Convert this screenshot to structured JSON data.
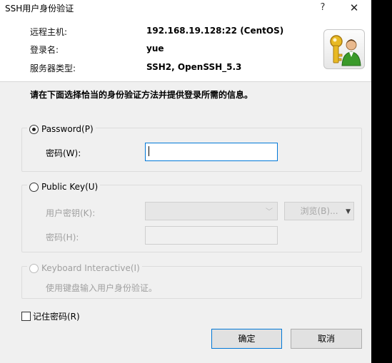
{
  "window": {
    "title": "SSH用户身份验证",
    "help_label": "?",
    "close_label": "✕"
  },
  "info": {
    "host_label": "远程主机:",
    "host_value": "192.168.19.128:22 (CentOS)",
    "login_label": "登录名:",
    "login_value": "yue",
    "server_type_label": "服务器类型:",
    "server_type_value": "SSH2, OpenSSH_5.3",
    "avatar_icon": "user-key-icon"
  },
  "instruction": "请在下面选择恰当的身份验证方法并提供登录所需的信息。",
  "password_method": {
    "label": "Password(P)",
    "selected": true,
    "password_label": "密码(W):",
    "password_value": ""
  },
  "publickey_method": {
    "label": "Public Key(U)",
    "selected": false,
    "user_key_label": "用户密钥(K):",
    "user_key_value": "",
    "browse_label": "浏览(B)...",
    "passphrase_label": "密码(H):",
    "passphrase_value": ""
  },
  "keyboard_method": {
    "label": "Keyboard Interactive(I)",
    "selected": false,
    "description": "使用键盘输入用户身份验证。"
  },
  "remember_password": {
    "label": "记住密码(R)",
    "checked": false
  },
  "buttons": {
    "ok_label": "确定",
    "cancel_label": "取消"
  },
  "colors": {
    "accent": "#0078d7",
    "dialog_bg": "#f0f0f0",
    "key_gold": "#d4a017",
    "user_green": "#3a9a2a"
  }
}
